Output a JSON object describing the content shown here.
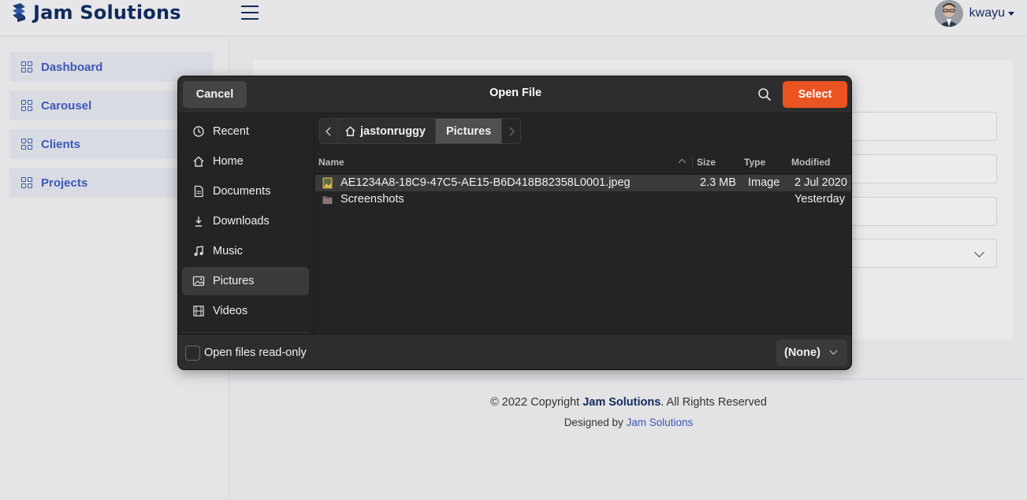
{
  "app": {
    "brand": "Jam Solutions",
    "user_name": "kwayu"
  },
  "sidebar": {
    "items": [
      {
        "label": "Dashboard",
        "icon": "grid-icon"
      },
      {
        "label": "Carousel",
        "icon": "grid-icon"
      },
      {
        "label": "Clients",
        "icon": "grid-icon"
      },
      {
        "label": "Projects",
        "icon": "grid-icon"
      }
    ]
  },
  "footer": {
    "copyright_prefix": "© 2022 Copyright ",
    "copyright_brand": "Jam Solutions",
    "copyright_suffix": ". All Rights Reserved",
    "designed_by_prefix": "Designed by ",
    "designed_by_link": "Jam Solutions"
  },
  "dialog": {
    "title": "Open File",
    "cancel_label": "Cancel",
    "select_label": "Select",
    "accent_color": "#e95420",
    "places": [
      {
        "label": "Recent",
        "icon": "clock-icon"
      },
      {
        "label": "Home",
        "icon": "home-icon"
      },
      {
        "label": "Documents",
        "icon": "document-icon"
      },
      {
        "label": "Downloads",
        "icon": "download-icon"
      },
      {
        "label": "Music",
        "icon": "music-icon"
      },
      {
        "label": "Pictures",
        "icon": "image-icon",
        "active": true
      },
      {
        "label": "Videos",
        "icon": "film-icon"
      }
    ],
    "path": {
      "segments": [
        "jastonruggy",
        "Pictures"
      ],
      "current": "Pictures"
    },
    "columns": {
      "name": "Name",
      "size": "Size",
      "type": "Type",
      "modified": "Modified"
    },
    "files": [
      {
        "name": "AE1234A8-18C9-47C5-AE15-B6D418B82358L0001.jpeg",
        "size": "2.3 MB",
        "type": "Image",
        "modified": "2 Jul 2020",
        "icon": "image-file-icon",
        "selected": true
      },
      {
        "name": "Screenshots",
        "size": "",
        "type": "",
        "modified": "Yesterday",
        "icon": "folder-icon",
        "selected": false
      }
    ],
    "read_only_label": "Open files read-only",
    "read_only_checked": false,
    "filter_label": "(None)"
  }
}
